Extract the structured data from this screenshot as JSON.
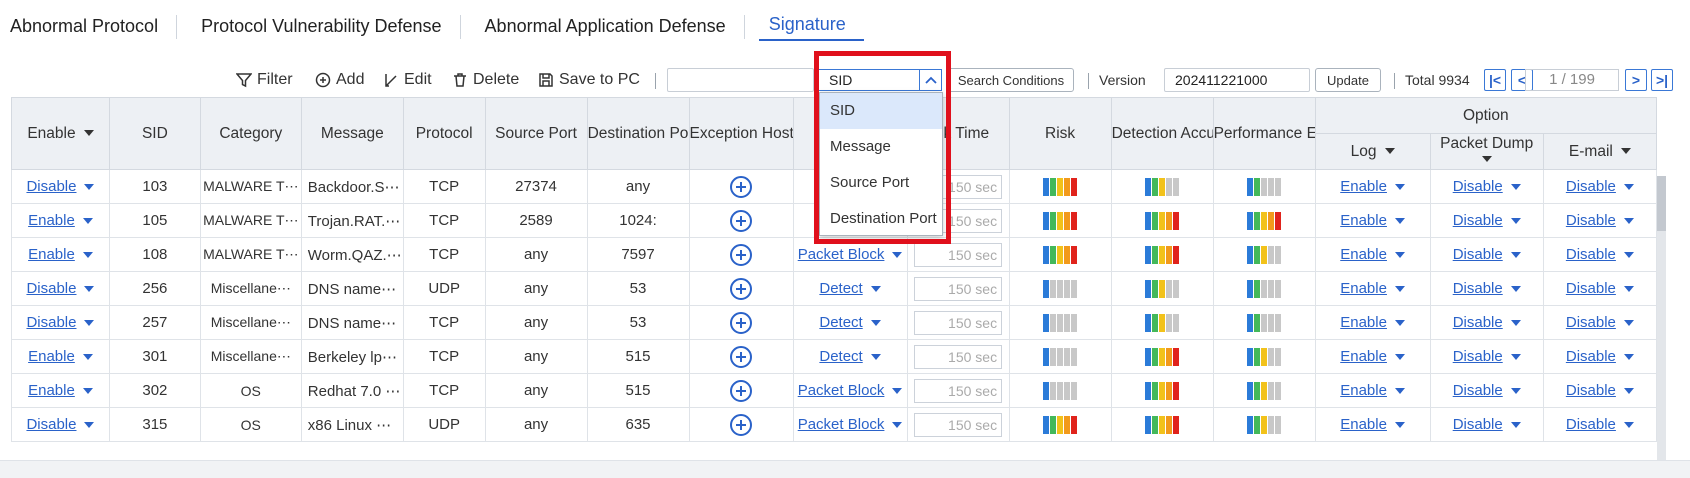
{
  "tabs": [
    "Abnormal Protocol",
    "Protocol Vulnerability Defense",
    "Abnormal Application Defense",
    "Signature"
  ],
  "toolbar": {
    "filter": "Filter",
    "add": "Add",
    "edit": "Edit",
    "delete": "Delete",
    "save": "Save to PC",
    "select_value": "SID",
    "search_conditions": "Search Conditions",
    "version_label": "Version",
    "version_value": "202411221000",
    "update": "Update",
    "total": "Total 9934",
    "page": "1 / 199"
  },
  "dropdown": [
    "SID",
    "Message",
    "Source Port",
    "Destination Port"
  ],
  "headers": {
    "enable": "Enable",
    "sid": "SID",
    "category": "Category",
    "message": "Message",
    "protocol": "Protocol",
    "src_port": "Source Port",
    "dst_port": "Destination Po",
    "exception": "Exception Host",
    "action": "",
    "block_time": "ock Time",
    "risk": "Risk",
    "detection": "Detection Accu",
    "performance": "Performance E",
    "option": "Option",
    "log": "Log",
    "packet_dump": "Packet Dump",
    "email": "E-mail"
  },
  "rows": [
    {
      "enable": "Disable",
      "sid": "103",
      "category": "MALWARE T⋯",
      "message": "Backdoor.S⋯",
      "protocol": "TCP",
      "src": "27374",
      "dst": "any",
      "action": "Pa",
      "block": "150 sec",
      "risk": 3,
      "detect": 2,
      "perf": 1,
      "log": "Enable",
      "dump": "Disable",
      "email": "Disable"
    },
    {
      "enable": "Enable",
      "sid": "105",
      "category": "MALWARE T⋯",
      "message": "Trojan.RAT.⋯",
      "protocol": "TCP",
      "src": "2589",
      "dst": "1024:",
      "action": "Pa",
      "block": "150 sec",
      "risk": 3,
      "detect": 3,
      "perf": 3,
      "log": "Enable",
      "dump": "Disable",
      "email": "Disable"
    },
    {
      "enable": "Enable",
      "sid": "108",
      "category": "MALWARE T⋯",
      "message": "Worm.QAZ.⋯",
      "protocol": "TCP",
      "src": "any",
      "dst": "7597",
      "action": "Packet Block",
      "block": "150 sec",
      "risk": 3,
      "detect": 3,
      "perf": 2,
      "log": "Enable",
      "dump": "Disable",
      "email": "Disable"
    },
    {
      "enable": "Disable",
      "sid": "256",
      "category": "Miscellane⋯",
      "message": "DNS name⋯",
      "protocol": "UDP",
      "src": "any",
      "dst": "53",
      "action": "Detect",
      "block": "150 sec",
      "risk": 0,
      "detect": 2,
      "perf": 1,
      "log": "Enable",
      "dump": "Disable",
      "email": "Disable"
    },
    {
      "enable": "Disable",
      "sid": "257",
      "category": "Miscellane⋯",
      "message": "DNS name⋯",
      "protocol": "TCP",
      "src": "any",
      "dst": "53",
      "action": "Detect",
      "block": "150 sec",
      "risk": 0,
      "detect": 2,
      "perf": 1,
      "log": "Enable",
      "dump": "Disable",
      "email": "Disable"
    },
    {
      "enable": "Enable",
      "sid": "301",
      "category": "Miscellane⋯",
      "message": "Berkeley lp⋯",
      "protocol": "TCP",
      "src": "any",
      "dst": "515",
      "action": "Detect",
      "block": "150 sec",
      "risk": 0,
      "detect": 3,
      "perf": 2,
      "log": "Enable",
      "dump": "Disable",
      "email": "Disable"
    },
    {
      "enable": "Enable",
      "sid": "302",
      "category": "OS",
      "message": "Redhat 7.0 ⋯",
      "protocol": "TCP",
      "src": "any",
      "dst": "515",
      "action": "Packet Block",
      "block": "150 sec",
      "risk": 0,
      "detect": 3,
      "perf": 2,
      "log": "Enable",
      "dump": "Disable",
      "email": "Disable"
    },
    {
      "enable": "Disable",
      "sid": "315",
      "category": "OS",
      "message": "x86 Linux ⋯",
      "protocol": "UDP",
      "src": "any",
      "dst": "635",
      "action": "Packet Block",
      "block": "150 sec",
      "risk": 3,
      "detect": 3,
      "perf": 2,
      "log": "Enable",
      "dump": "Disable",
      "email": "Disable"
    }
  ],
  "colors": {
    "accent": "#2a62c9",
    "highlight": "#e0101c"
  }
}
